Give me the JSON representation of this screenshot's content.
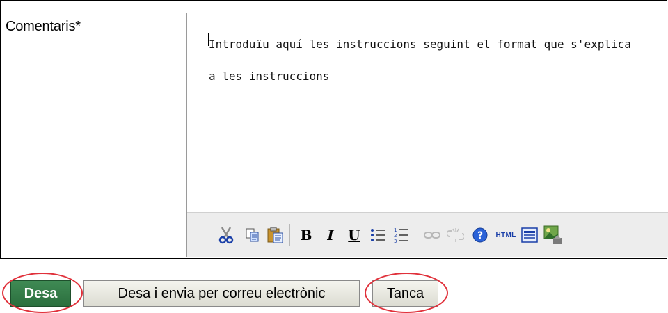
{
  "form": {
    "comments_label": "Comentaris*",
    "editor_line1": "Introduïu aquí les instruccions seguint el format que s'explica",
    "editor_line2": "a les instruccions"
  },
  "toolbar": {
    "icons": [
      "cut-icon",
      "copy-icon",
      "paste-icon",
      "bold-icon",
      "italic-icon",
      "underline-icon",
      "bullet-list-icon",
      "numbered-list-icon",
      "link-icon",
      "unlink-icon",
      "help-icon",
      "html-source-icon",
      "template-icon",
      "image-icon"
    ],
    "bold_glyph": "B",
    "italic_glyph": "I",
    "underline_glyph": "U",
    "html_glyph": "HTML"
  },
  "buttons": {
    "save": "Desa",
    "save_and_email": "Desa i envia per correu electrònic",
    "close": "Tanca"
  },
  "colors": {
    "save_button": "#2e7340",
    "highlight_ellipse": "#e0303a"
  }
}
